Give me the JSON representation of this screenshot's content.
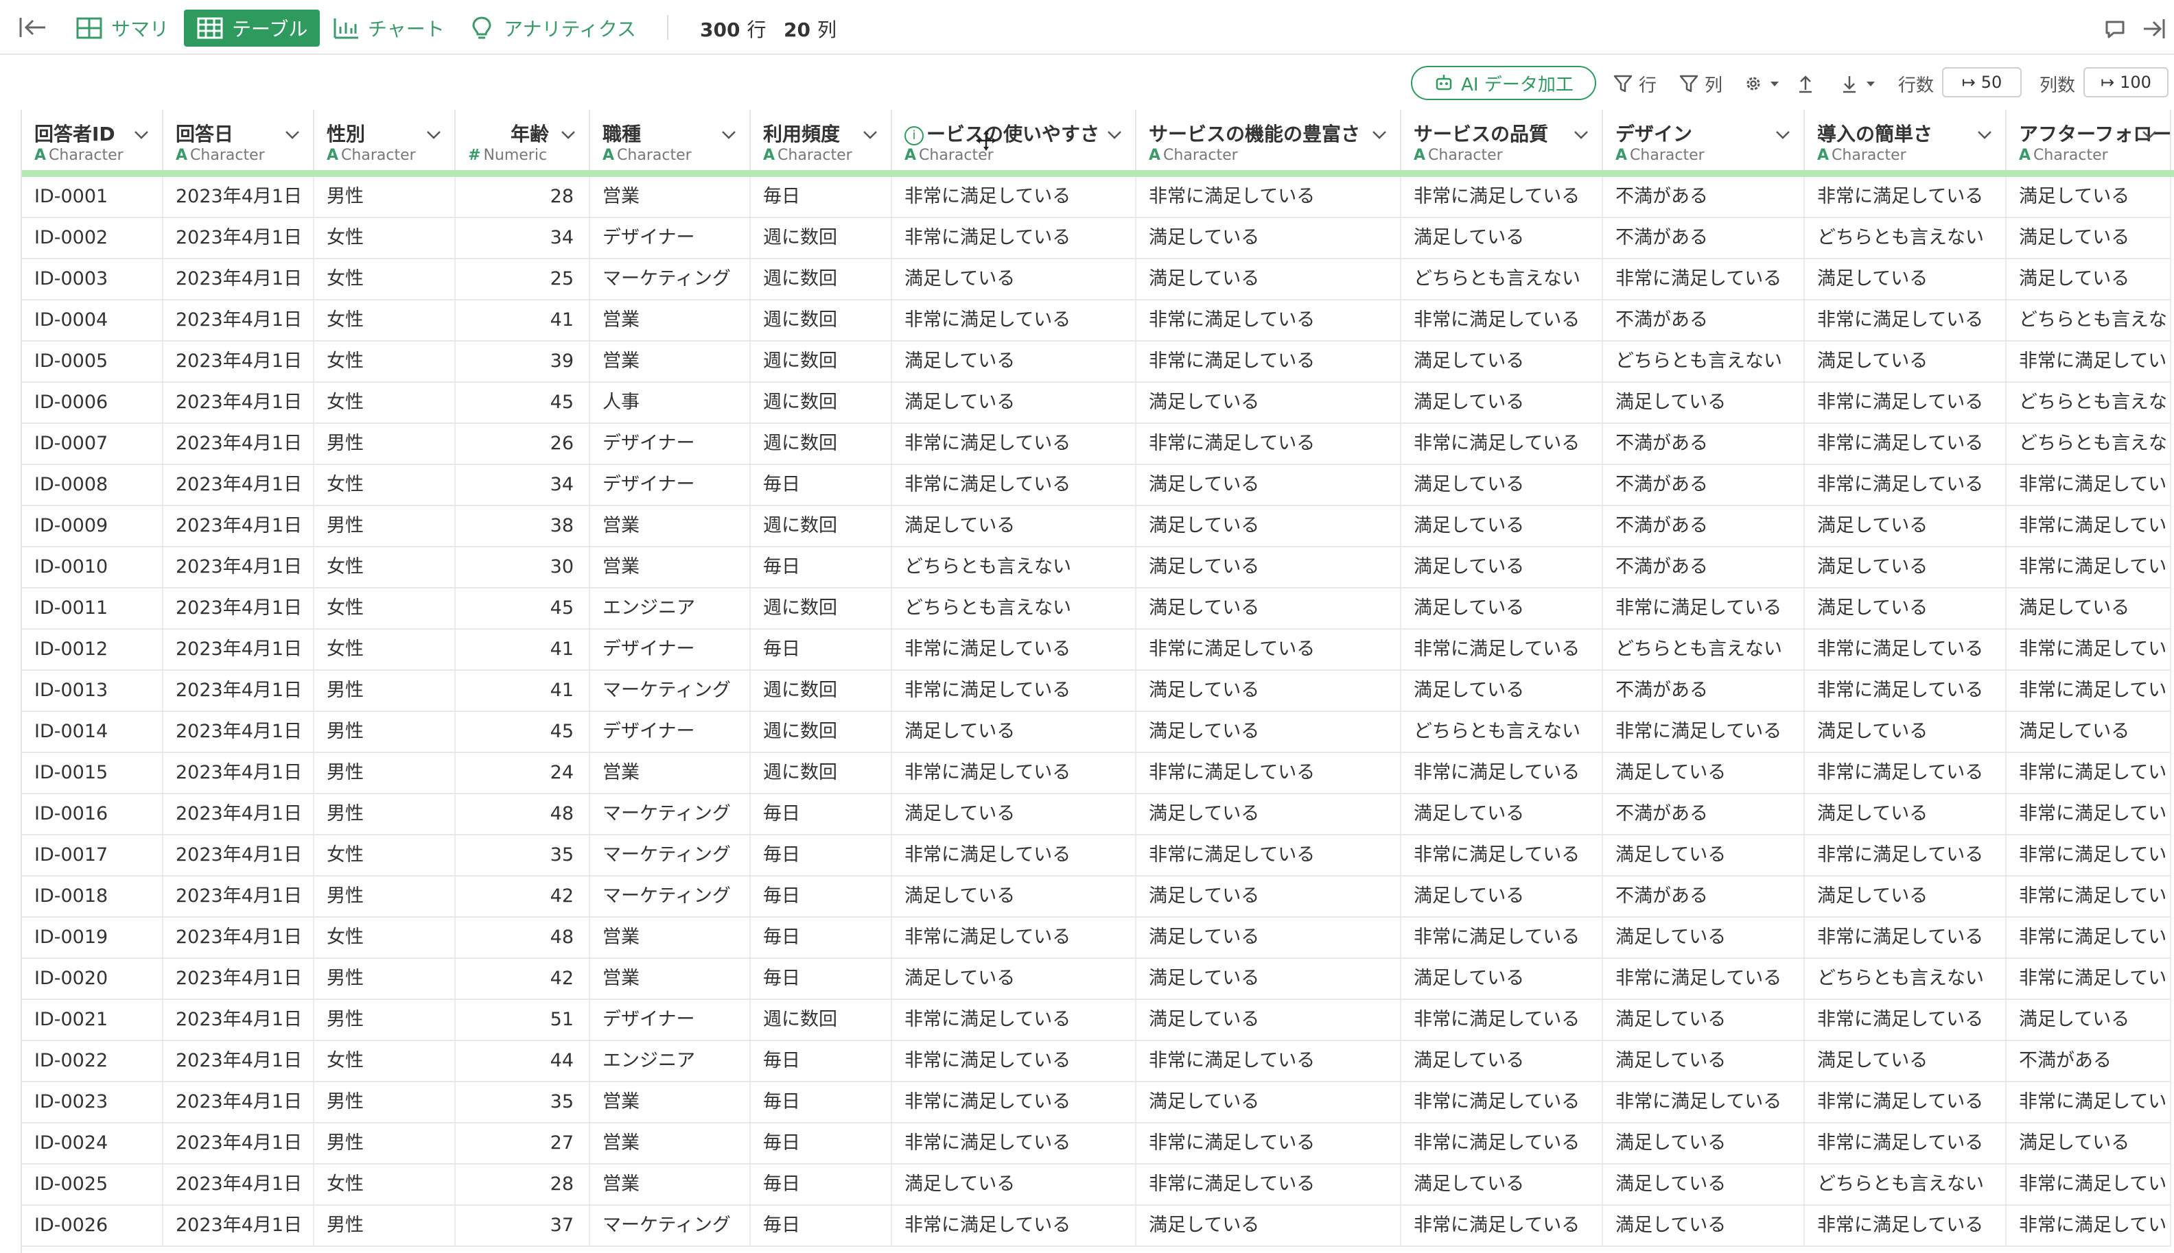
{
  "nav": {
    "tabs": [
      {
        "label": "サマリ",
        "icon": "summary-grid-icon"
      },
      {
        "label": "テーブル",
        "icon": "table-icon",
        "active": true
      },
      {
        "label": "チャート",
        "icon": "chart-icon"
      },
      {
        "label": "アナリティクス",
        "icon": "lightbulb-icon"
      }
    ],
    "rows_count": "300",
    "rows_unit": "行",
    "cols_count": "20",
    "cols_unit": "列"
  },
  "toolbar": {
    "ai_button": "AI データ加工",
    "row_filter": "行",
    "col_filter": "列",
    "rows_label": "行数",
    "rows_value": "50",
    "cols_label": "列数",
    "cols_value": "100"
  },
  "colors": {
    "accent": "#2e9a5e",
    "header_bar": "#b6e8b6"
  },
  "columns": [
    {
      "name": "回答者ID",
      "type": "Character",
      "glyph": "A"
    },
    {
      "name": "回答日",
      "type": "Character",
      "glyph": "A"
    },
    {
      "name": "性別",
      "type": "Character",
      "glyph": "A"
    },
    {
      "name": "年齢",
      "type": "Numeric",
      "glyph": "#"
    },
    {
      "name": "職種",
      "type": "Character",
      "glyph": "A"
    },
    {
      "name": "利用頻度",
      "type": "Character",
      "glyph": "A"
    },
    {
      "name": "ービスの使いやすさ",
      "type": "Character",
      "glyph": "A",
      "info_icon": "i"
    },
    {
      "name": "サービスの機能の豊富さ",
      "type": "Character",
      "glyph": "A"
    },
    {
      "name": "サービスの品質",
      "type": "Character",
      "glyph": "A"
    },
    {
      "name": "デザイン",
      "type": "Character",
      "glyph": "A"
    },
    {
      "name": "導入の簡単さ",
      "type": "Character",
      "glyph": "A"
    },
    {
      "name": "アフターフォロー",
      "type": "Character",
      "glyph": "A"
    }
  ],
  "rows": [
    [
      "ID-0001",
      "2023年4月1日",
      "男性",
      "28",
      "営業",
      "毎日",
      "非常に満足している",
      "非常に満足している",
      "非常に満足している",
      "不満がある",
      "非常に満足している",
      "満足している"
    ],
    [
      "ID-0002",
      "2023年4月1日",
      "女性",
      "34",
      "デザイナー",
      "週に数回",
      "非常に満足している",
      "満足している",
      "満足している",
      "不満がある",
      "どちらとも言えない",
      "満足している"
    ],
    [
      "ID-0003",
      "2023年4月1日",
      "女性",
      "25",
      "マーケティング",
      "週に数回",
      "満足している",
      "満足している",
      "どちらとも言えない",
      "非常に満足している",
      "満足している",
      "満足している"
    ],
    [
      "ID-0004",
      "2023年4月1日",
      "女性",
      "41",
      "営業",
      "週に数回",
      "非常に満足している",
      "非常に満足している",
      "非常に満足している",
      "不満がある",
      "非常に満足している",
      "どちらとも言えな"
    ],
    [
      "ID-0005",
      "2023年4月1日",
      "女性",
      "39",
      "営業",
      "週に数回",
      "満足している",
      "非常に満足している",
      "満足している",
      "どちらとも言えない",
      "満足している",
      "非常に満足してい"
    ],
    [
      "ID-0006",
      "2023年4月1日",
      "女性",
      "45",
      "人事",
      "週に数回",
      "満足している",
      "満足している",
      "満足している",
      "満足している",
      "非常に満足している",
      "どちらとも言えな"
    ],
    [
      "ID-0007",
      "2023年4月1日",
      "男性",
      "26",
      "デザイナー",
      "週に数回",
      "非常に満足している",
      "非常に満足している",
      "非常に満足している",
      "不満がある",
      "非常に満足している",
      "どちらとも言えな"
    ],
    [
      "ID-0008",
      "2023年4月1日",
      "女性",
      "34",
      "デザイナー",
      "毎日",
      "非常に満足している",
      "満足している",
      "満足している",
      "不満がある",
      "非常に満足している",
      "非常に満足してい"
    ],
    [
      "ID-0009",
      "2023年4月1日",
      "男性",
      "38",
      "営業",
      "週に数回",
      "満足している",
      "満足している",
      "満足している",
      "不満がある",
      "満足している",
      "非常に満足してい"
    ],
    [
      "ID-0010",
      "2023年4月1日",
      "女性",
      "30",
      "営業",
      "毎日",
      "どちらとも言えない",
      "満足している",
      "満足している",
      "不満がある",
      "満足している",
      "非常に満足してい"
    ],
    [
      "ID-0011",
      "2023年4月1日",
      "女性",
      "45",
      "エンジニア",
      "週に数回",
      "どちらとも言えない",
      "満足している",
      "満足している",
      "非常に満足している",
      "満足している",
      "満足している"
    ],
    [
      "ID-0012",
      "2023年4月1日",
      "女性",
      "41",
      "デザイナー",
      "毎日",
      "非常に満足している",
      "非常に満足している",
      "非常に満足している",
      "どちらとも言えない",
      "非常に満足している",
      "非常に満足してい"
    ],
    [
      "ID-0013",
      "2023年4月1日",
      "男性",
      "41",
      "マーケティング",
      "週に数回",
      "非常に満足している",
      "満足している",
      "満足している",
      "不満がある",
      "非常に満足している",
      "非常に満足してい"
    ],
    [
      "ID-0014",
      "2023年4月1日",
      "男性",
      "45",
      "デザイナー",
      "週に数回",
      "満足している",
      "満足している",
      "どちらとも言えない",
      "非常に満足している",
      "満足している",
      "満足している"
    ],
    [
      "ID-0015",
      "2023年4月1日",
      "男性",
      "24",
      "営業",
      "週に数回",
      "非常に満足している",
      "非常に満足している",
      "非常に満足している",
      "満足している",
      "非常に満足している",
      "非常に満足してい"
    ],
    [
      "ID-0016",
      "2023年4月1日",
      "男性",
      "48",
      "マーケティング",
      "毎日",
      "満足している",
      "満足している",
      "満足している",
      "不満がある",
      "満足している",
      "非常に満足してい"
    ],
    [
      "ID-0017",
      "2023年4月1日",
      "女性",
      "35",
      "マーケティング",
      "毎日",
      "非常に満足している",
      "非常に満足している",
      "非常に満足している",
      "満足している",
      "非常に満足している",
      "非常に満足してい"
    ],
    [
      "ID-0018",
      "2023年4月1日",
      "男性",
      "42",
      "マーケティング",
      "毎日",
      "満足している",
      "満足している",
      "満足している",
      "不満がある",
      "満足している",
      "非常に満足してい"
    ],
    [
      "ID-0019",
      "2023年4月1日",
      "女性",
      "48",
      "営業",
      "毎日",
      "非常に満足している",
      "満足している",
      "非常に満足している",
      "満足している",
      "非常に満足している",
      "非常に満足してい"
    ],
    [
      "ID-0020",
      "2023年4月1日",
      "男性",
      "42",
      "営業",
      "毎日",
      "満足している",
      "満足している",
      "満足している",
      "非常に満足している",
      "どちらとも言えない",
      "非常に満足してい"
    ],
    [
      "ID-0021",
      "2023年4月1日",
      "男性",
      "51",
      "デザイナー",
      "週に数回",
      "非常に満足している",
      "満足している",
      "非常に満足している",
      "満足している",
      "非常に満足している",
      "満足している"
    ],
    [
      "ID-0022",
      "2023年4月1日",
      "女性",
      "44",
      "エンジニア",
      "毎日",
      "非常に満足している",
      "非常に満足している",
      "満足している",
      "満足している",
      "満足している",
      "不満がある"
    ],
    [
      "ID-0023",
      "2023年4月1日",
      "男性",
      "35",
      "営業",
      "毎日",
      "非常に満足している",
      "満足している",
      "非常に満足している",
      "非常に満足している",
      "非常に満足している",
      "非常に満足してい"
    ],
    [
      "ID-0024",
      "2023年4月1日",
      "男性",
      "27",
      "営業",
      "毎日",
      "非常に満足している",
      "非常に満足している",
      "非常に満足している",
      "満足している",
      "非常に満足している",
      "満足している"
    ],
    [
      "ID-0025",
      "2023年4月1日",
      "女性",
      "28",
      "営業",
      "毎日",
      "満足している",
      "非常に満足している",
      "満足している",
      "満足している",
      "どちらとも言えない",
      "非常に満足してい"
    ],
    [
      "ID-0026",
      "2023年4月1日",
      "男性",
      "37",
      "マーケティング",
      "毎日",
      "非常に満足している",
      "満足している",
      "非常に満足している",
      "満足している",
      "非常に満足している",
      "非常に満足してい"
    ]
  ]
}
